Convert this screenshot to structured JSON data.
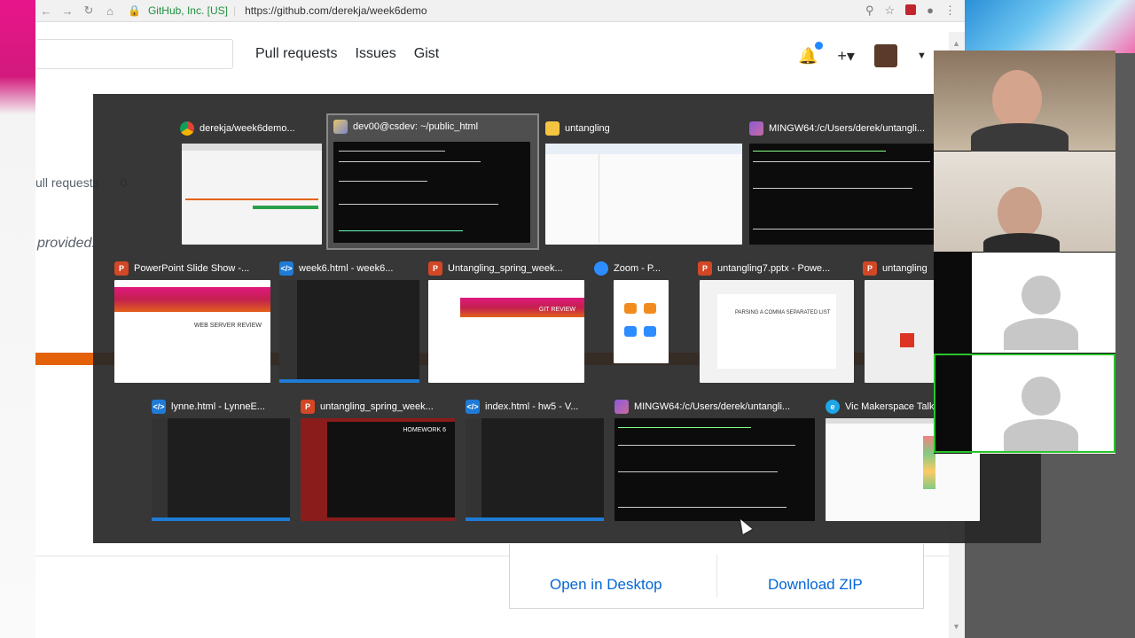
{
  "browser": {
    "secure_label": "GitHub, Inc. [US]",
    "url": "https://github.com/derekja/week6demo"
  },
  "github": {
    "nav": [
      "Pull requests",
      "Issues",
      "Gist"
    ],
    "bg_pull_requests": "ull requests",
    "bg_pull_count": "0",
    "bg_provided": "provided.",
    "open_desktop": "Open in Desktop",
    "download_zip": "Download ZIP"
  },
  "switcher": {
    "windows": [
      {
        "title": "derekja/week6demo...",
        "icon": "chrome-icon"
      },
      {
        "title": "dev00@csdev: ~/public_html",
        "icon": "putty-icon",
        "selected": true
      },
      {
        "title": "untangling",
        "icon": "folder-icon"
      },
      {
        "title": "MINGW64:/c/Users/derek/untangli...",
        "icon": "git-bash-icon"
      },
      {
        "title": "PowerPoint Slide Show -...",
        "icon": "powerpoint-icon"
      },
      {
        "title": "week6.html - week6...",
        "icon": "vscode-icon"
      },
      {
        "title": "Untangling_spring_week...",
        "icon": "powerpoint-icon"
      },
      {
        "title": "Zoom - P...",
        "icon": "zoom-icon"
      },
      {
        "title": "untangling7.pptx - Powe...",
        "icon": "powerpoint-icon"
      },
      {
        "title": "untangling",
        "icon": "powerpoint-icon"
      },
      {
        "title": "lynne.html - LynneE...",
        "icon": "vscode-icon"
      },
      {
        "title": "untangling_spring_week...",
        "icon": "powerpoint-icon"
      },
      {
        "title": "index.html - hw5 - V...",
        "icon": "vscode-icon"
      },
      {
        "title": "MINGW64:/c/Users/derek/untangli...",
        "icon": "git-bash-icon"
      },
      {
        "title": "Vic Makerspace Talk",
        "icon": "internet-explorer-icon"
      }
    ],
    "slide_labels": {
      "web_server_review": "WEB SERVER REVIEW",
      "git_review": "GIT REVIEW",
      "parsing": "PARSING A COMMA SEPARATED LIST",
      "homework": "HOMEWORK 6"
    }
  },
  "colors": {
    "github_link": "#0366d6",
    "accent_orange": "#e36209",
    "cam_active": "#29c429"
  }
}
